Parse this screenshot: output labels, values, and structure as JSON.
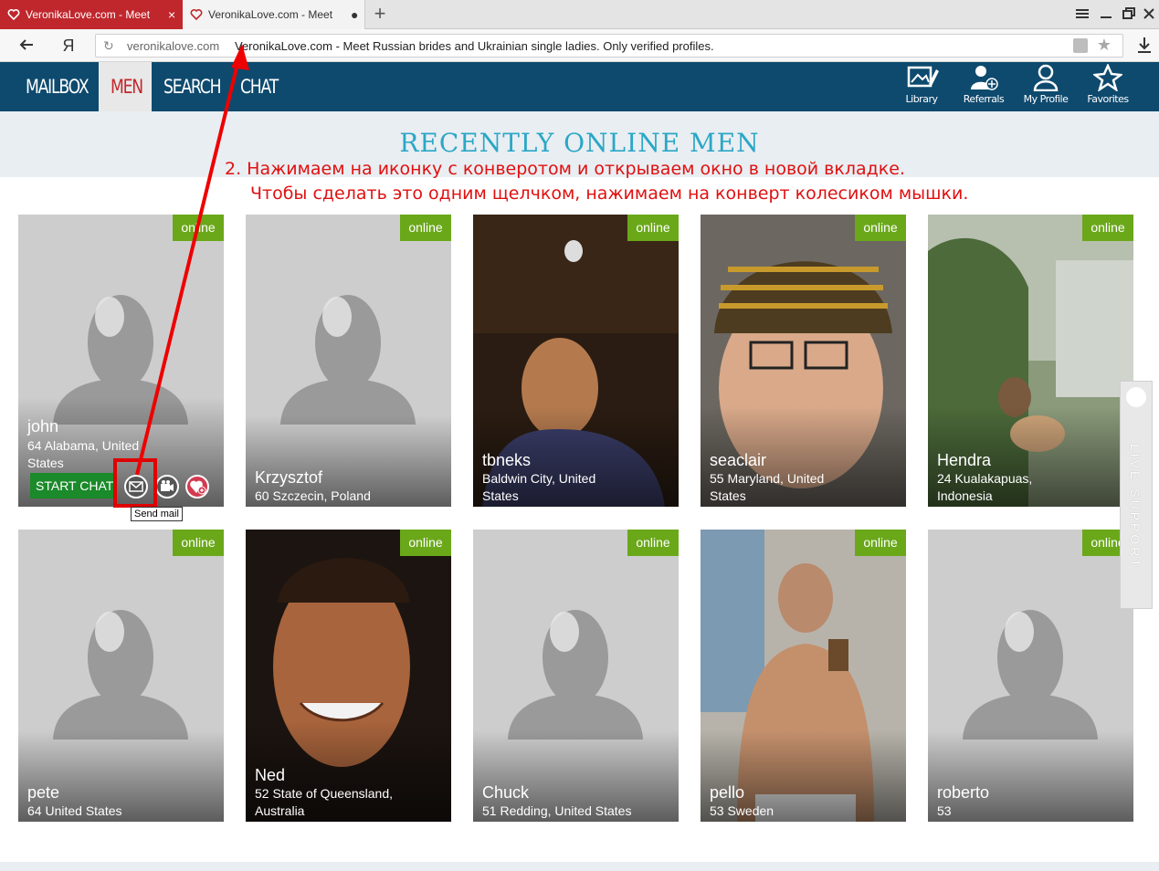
{
  "browser": {
    "tabs": [
      {
        "title": "VeronikaLove.com - Meet",
        "active": true
      },
      {
        "title": "VeronikaLove.com - Meet",
        "active": false
      }
    ],
    "new_tab": "+",
    "yandex_logo": "Я",
    "url_domain": "veronikalove.com",
    "page_title": "VeronikaLove.com - Meet Russian brides and Ukrainian single ladies. Only verified profiles."
  },
  "nav": {
    "mailbox": "MAILBOX",
    "men": "MEN",
    "search": "SEARCH",
    "chat": "CHAT"
  },
  "header_icons": {
    "library": "Library",
    "referrals": "Referrals",
    "my_profile": "My Profile",
    "favorites": "Favorites"
  },
  "page": {
    "heading": "RECENTLY ONLINE MEN",
    "annotation_line1": "2. Нажимаем на иконку с конверотом и открываем окно в новой вкладке.",
    "annotation_line2": "Чтобы сделать это одним щелчком, нажимаем на конверт колесиком мышки.",
    "start_chat": "START CHAT",
    "tooltip": "Send mail",
    "live_support": "LIVE SUPPORT"
  },
  "profiles": [
    {
      "name": "john",
      "location": "64 Alabama, United States",
      "status": "online"
    },
    {
      "name": "Krzysztof",
      "location": "60 Szczecin, Poland",
      "status": "online"
    },
    {
      "name": "tbneks",
      "location": "Baldwin City, United States",
      "status": "online"
    },
    {
      "name": "seaclair",
      "location": "55 Maryland, United States",
      "status": "online"
    },
    {
      "name": "Hendra",
      "location": "24 Kualakapuas, Indonesia",
      "status": "online"
    },
    {
      "name": "pete",
      "location": "64 United States",
      "status": "online"
    },
    {
      "name": "Ned",
      "location": "52 State of Queensland, Australia",
      "status": "online"
    },
    {
      "name": "Chuck",
      "location": "51 Redding, United States",
      "status": "online"
    },
    {
      "name": "pello",
      "location": "53 Sweden",
      "status": "online"
    },
    {
      "name": "roberto",
      "location": "53",
      "status": "online"
    }
  ],
  "colors": {
    "brand_red": "#c1272d",
    "header_blue": "#0e4a6e",
    "heading_teal": "#2aa7c6",
    "online_green": "#6aa81a",
    "annotation_red": "#e01010"
  },
  "icons": [
    "heart-favicon-icon",
    "close-icon",
    "menu-icon",
    "minimize-icon",
    "restore-icon",
    "close-window-icon",
    "back-arrow-icon",
    "reload-icon",
    "lock-icon",
    "star-icon",
    "download-icon",
    "library-icon",
    "referrals-icon",
    "profile-icon",
    "favorites-star-icon",
    "mail-icon",
    "video-icon",
    "heart-plus-icon",
    "chat-bubble-icon"
  ]
}
